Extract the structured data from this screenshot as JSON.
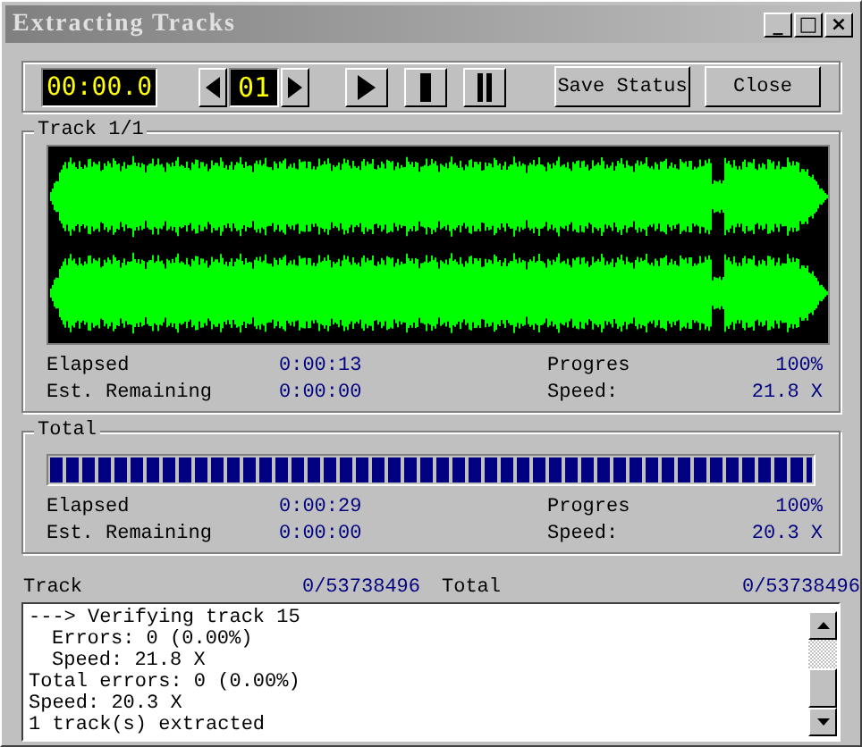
{
  "window": {
    "title": "Extracting Tracks",
    "controls": [
      "_",
      "□",
      "×"
    ]
  },
  "toolbar": {
    "time": "00:00.0",
    "track_number": "01",
    "buttons": [
      "Save Status",
      "Close"
    ]
  },
  "track": {
    "title": "Track 1/1",
    "stats": [
      {
        "label": "Elapsed",
        "value": "0:00:13",
        "label2": "Progres",
        "value2": "100%"
      },
      {
        "label": "Est. Remaining",
        "value": "0:00:00",
        "label2": "Speed:",
        "value2": "21.8 X"
      }
    ]
  },
  "total": {
    "title": "Total",
    "level": 1.0,
    "stats": [
      {
        "label": "Elapsed",
        "value": "0:00:29",
        "label2": "Progres",
        "value2": "100%"
      },
      {
        "label": "Est. Remaining",
        "value": "0:00:00",
        "label2": "Speed:",
        "value2": "20.3 X"
      }
    ]
  },
  "bytes": {
    "track_label": "Track",
    "track_value": "0/53738496",
    "total_label": "Total",
    "total_value": "0/53738496"
  },
  "log": [
    {
      "kind": "main",
      "text": "---> Verifying track 15"
    },
    {
      "kind": "sub",
      "text": "Errors: 0 (0.00%)"
    },
    {
      "kind": "sub",
      "text": "Speed: 21.8 X"
    },
    {
      "kind": "main",
      "text": "Total errors: 0 (0.00%)"
    },
    {
      "kind": "main",
      "text": "Speed: 20.3 X"
    },
    {
      "kind": "main",
      "text": "1 track(s) extracted"
    }
  ]
}
